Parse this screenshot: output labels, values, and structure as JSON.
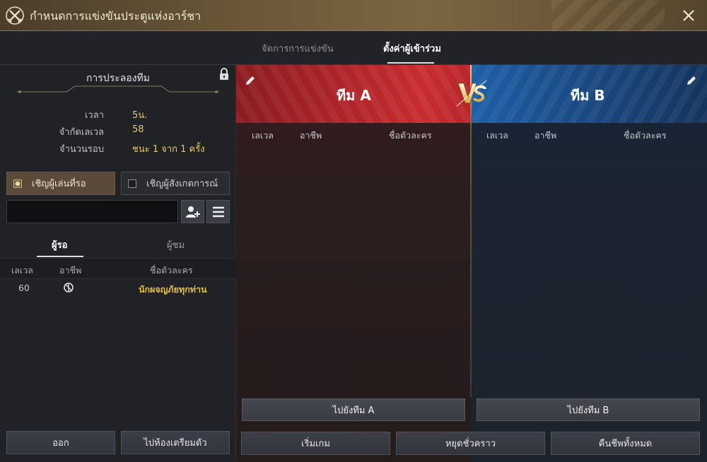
{
  "window": {
    "title": "กำหนดการแข่งขันประตูแห่งอาร์ชา",
    "icon": "crossed-swords-emblem-icon",
    "close_icon": "close-icon"
  },
  "tabs": [
    {
      "label": "จัดการการแข่งขัน",
      "active": false
    },
    {
      "label": "ตั้งค่าผู้เข้าร่วม",
      "active": true
    }
  ],
  "match": {
    "title": "การประลองทีม",
    "lock_icon": "lock-icon",
    "time_label": "เวลา",
    "time_value": "5น.",
    "level_label": "จำกัดเลเวล",
    "level_value": "58",
    "rounds_label": "จำนวนรอบ",
    "rounds_value": "ชนะ 1 จาก 1 ครั้ง"
  },
  "invite": {
    "waiting_label": "เชิญผู้เล่นที่รอ",
    "waiting_checked": true,
    "spectator_label": "เชิญผู้สังเกตการณ์",
    "spectator_checked": false
  },
  "search": {
    "value": "",
    "add_icon": "add-user-icon",
    "menu_icon": "menu-icon"
  },
  "list": {
    "tabs": [
      "ผู้รอ",
      "ผู้ชม"
    ],
    "headers": {
      "level": "เลเวล",
      "class": "อาชีพ",
      "name": "ชื่อตัวละคร"
    },
    "rows": [
      {
        "level": "60",
        "class_icon": "class-emblem-icon",
        "name": "นักผจญภัยทุกท่าน"
      }
    ]
  },
  "left_buttons": {
    "exit": "ออก",
    "ready_room": "ไปห้องเตรียมตัว"
  },
  "teams": {
    "a": {
      "name": "ทีม A",
      "goto": "ไปยังทีม A",
      "color": "#c82d2f"
    },
    "b": {
      "name": "ทีม B",
      "goto": "ไปยังทีม B",
      "color": "#1d5fa8"
    },
    "headers": {
      "level": "เลเวล",
      "class": "อาชีพ",
      "name": "ชื่อตัวละคร"
    },
    "vs_icon": "vs-icon",
    "edit_icon": "pencil-icon"
  },
  "bottom_buttons": {
    "start": "เริ่มเกม",
    "pause": "หยุดชั่วคราว",
    "revive_all": "คืนชีพทั้งหมด"
  },
  "colors": {
    "accent_gold": "#e8c86a",
    "name_yellow": "#e8c040"
  }
}
